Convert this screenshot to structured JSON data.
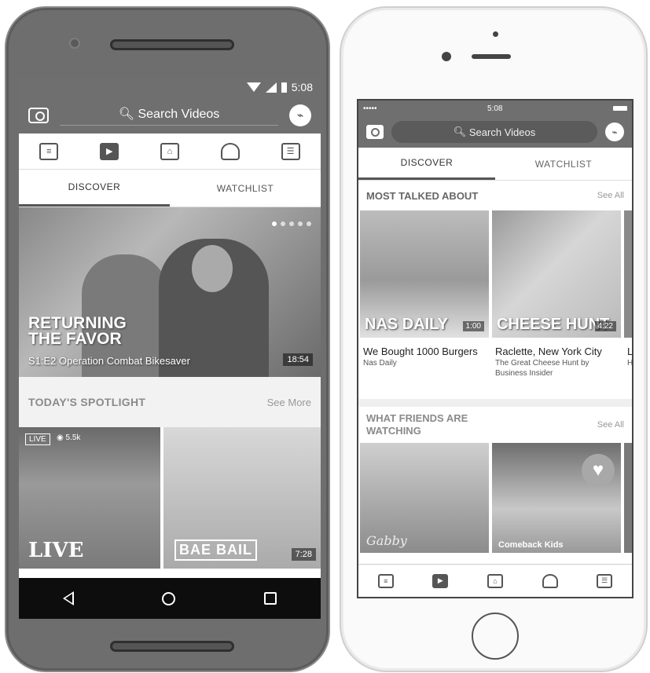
{
  "android": {
    "status": {
      "time": "5:08"
    },
    "search": {
      "placeholder": "Search Videos"
    },
    "tabs": [
      {
        "label": "DISCOVER",
        "active": true
      },
      {
        "label": "WATCHLIST",
        "active": false
      }
    ],
    "nav_icons": [
      "news-feed-icon",
      "watch-icon",
      "marketplace-icon",
      "notifications-icon",
      "menu-icon"
    ],
    "hero": {
      "title": "RETURNING THE FAVOR",
      "episode": "S1:E2 Operation Combat Bikesaver",
      "duration": "18:54"
    },
    "spotlight": {
      "title": "TODAY'S SPOTLIGHT",
      "see_more": "See More",
      "tiles": [
        {
          "badge": "LIVE",
          "views": "5.5k",
          "logo": "LIVE"
        },
        {
          "logo": "BAE BAIL",
          "duration": "7:28"
        }
      ]
    }
  },
  "iphone": {
    "status": {
      "time": "5:08"
    },
    "search": {
      "placeholder": "Search Videos"
    },
    "tabs": [
      {
        "label": "DISCOVER",
        "active": true
      },
      {
        "label": "WATCHLIST",
        "active": false
      }
    ],
    "most_talked": {
      "title": "MOST TALKED ABOUT",
      "see_all": "See All",
      "cards": [
        {
          "thumb_label": "NAS DAILY",
          "duration": "1:00",
          "title": "We Bought 1000 Burgers",
          "subtitle": "Nas Daily"
        },
        {
          "thumb_label": "CHEESE HUNT",
          "duration": "4:22",
          "title": "Raclette, New York City",
          "subtitle": "The Great Cheese Hunt by Business Insider"
        },
        {
          "title": "Lo",
          "subtitle": "He"
        }
      ]
    },
    "friends": {
      "title": "WHAT FRIENDS ARE WATCHING",
      "see_all": "See All",
      "cards": [
        {
          "label": "Gabby"
        },
        {
          "label": "Comeback Kids"
        }
      ]
    },
    "tab_icons": [
      "news-feed-icon",
      "watch-icon",
      "marketplace-icon",
      "notifications-icon",
      "menu-icon"
    ]
  }
}
